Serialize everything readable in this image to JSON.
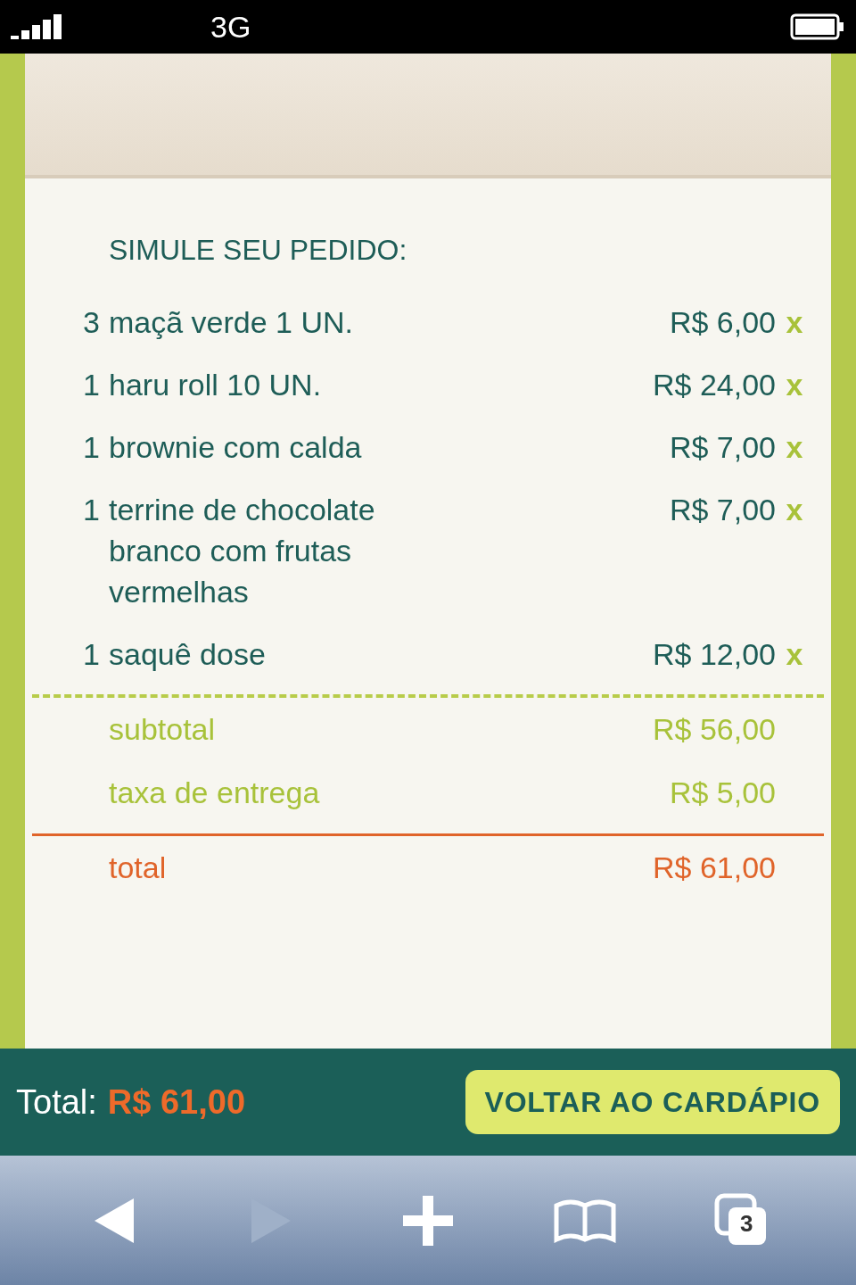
{
  "status_bar": {
    "network": "3G"
  },
  "order": {
    "title": "SIMULE SEU PEDIDO:",
    "items": [
      {
        "qty": "3",
        "name": "maçã verde 1 UN.",
        "price": "R$ 6,00",
        "remove": "x"
      },
      {
        "qty": "1",
        "name": "haru roll 10 UN.",
        "price": "R$ 24,00",
        "remove": "x"
      },
      {
        "qty": "1",
        "name": "brownie com calda",
        "price": "R$ 7,00",
        "remove": "x"
      },
      {
        "qty": "1",
        "name": "terrine de chocolate branco com frutas vermelhas",
        "price": "R$ 7,00",
        "remove": "x"
      },
      {
        "qty": "1",
        "name": "saquê dose",
        "price": "R$ 12,00",
        "remove": "x"
      }
    ],
    "subtotal": {
      "label": "subtotal",
      "value": "R$ 56,00"
    },
    "delivery": {
      "label": "taxa de entrega",
      "value": "R$ 5,00"
    },
    "total": {
      "label": "total",
      "value": "R$ 61,00"
    }
  },
  "bottom_bar": {
    "label": "Total:",
    "value": "R$ 61,00",
    "button": "VOLTAR AO CARDÁPIO"
  },
  "browser_toolbar": [
    {
      "kind": "back",
      "disabled": false
    },
    {
      "kind": "forward",
      "disabled": true
    },
    {
      "kind": "add",
      "disabled": false
    },
    {
      "kind": "bookmarks",
      "disabled": false
    },
    {
      "kind": "tabs",
      "disabled": false,
      "count": "3"
    }
  ]
}
